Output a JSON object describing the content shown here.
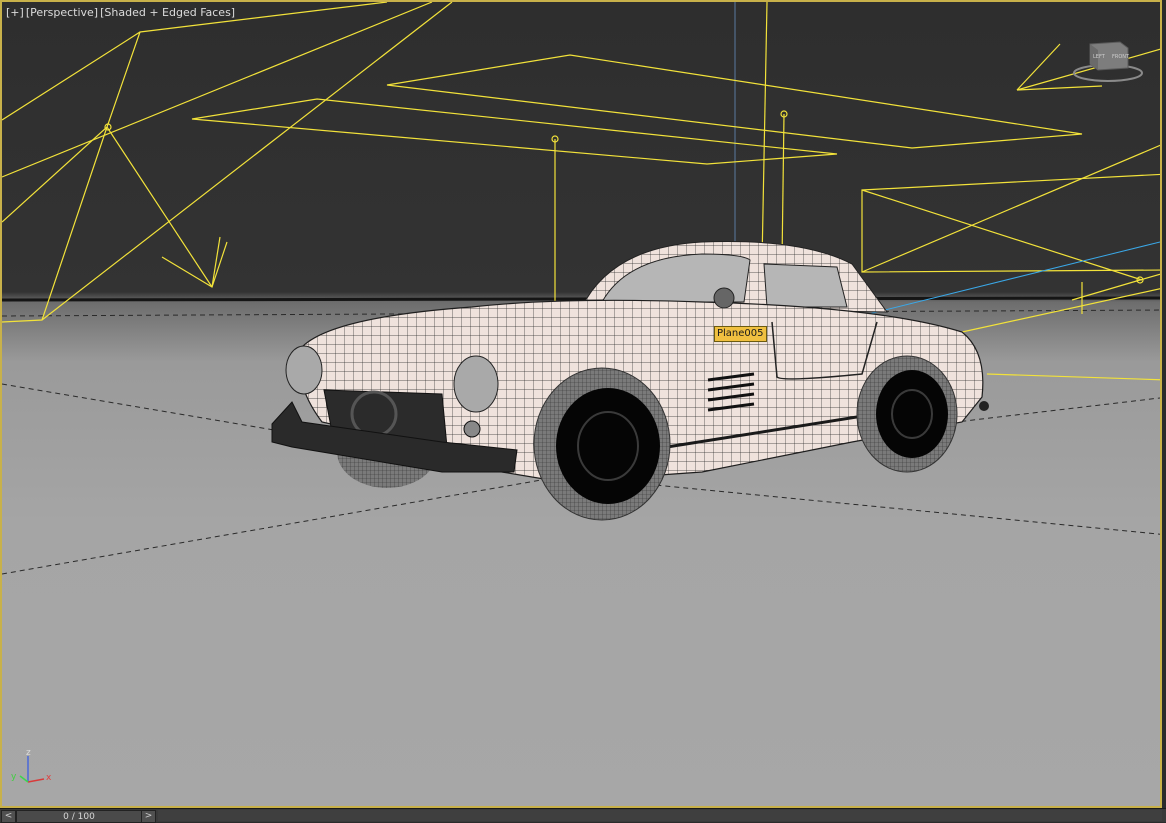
{
  "viewport": {
    "label_parts": [
      "[+]",
      "[Perspective]",
      "[Shaded + Edged Faces]"
    ],
    "selected_object_label": "Plane005",
    "border_color": "#c8b14a",
    "light_color": "#f2e23a",
    "viewcube": {
      "face_labels": [
        "LEFT",
        "FRONT"
      ]
    },
    "axes": {
      "x": "x",
      "y": "y",
      "z": "z"
    }
  },
  "timeline": {
    "prev_label": "<",
    "next_label": ">",
    "frame_display": "0 / 100"
  }
}
